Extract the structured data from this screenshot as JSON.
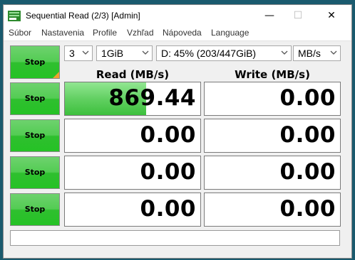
{
  "window": {
    "title": "Sequential Read (2/3) [Admin]",
    "minimize_glyph": "—",
    "maximize_glyph": "☐",
    "close_glyph": "✕"
  },
  "menu": [
    {
      "label": "Súbor"
    },
    {
      "label": "Nastavenia"
    },
    {
      "label": "Profile"
    },
    {
      "label": "Vzhľad"
    },
    {
      "label": "Nápoveda"
    },
    {
      "label": "Language"
    }
  ],
  "controls": {
    "count": "3",
    "size": "1GiB",
    "drive": "D: 45% (203/447GiB)",
    "unit": "MB/s"
  },
  "all_button": {
    "label": "Stop"
  },
  "headers": {
    "read": "Read (MB/s)",
    "write": "Write (MB/s)"
  },
  "rows": [
    {
      "button": "Stop",
      "read": "869.44",
      "write": "0.00",
      "read_fill": 0.6,
      "write_fill": 0
    },
    {
      "button": "Stop",
      "read": "0.00",
      "write": "0.00",
      "read_fill": 0,
      "write_fill": 0
    },
    {
      "button": "Stop",
      "read": "0.00",
      "write": "0.00",
      "read_fill": 0,
      "write_fill": 0
    },
    {
      "button": "Stop",
      "read": "0.00",
      "write": "0.00",
      "read_fill": 0,
      "write_fill": 0
    }
  ],
  "comment": "",
  "colors": {
    "button_green": "#2fbf2f",
    "bar_green": "#62d062",
    "corner_orange": "#f0a030"
  }
}
